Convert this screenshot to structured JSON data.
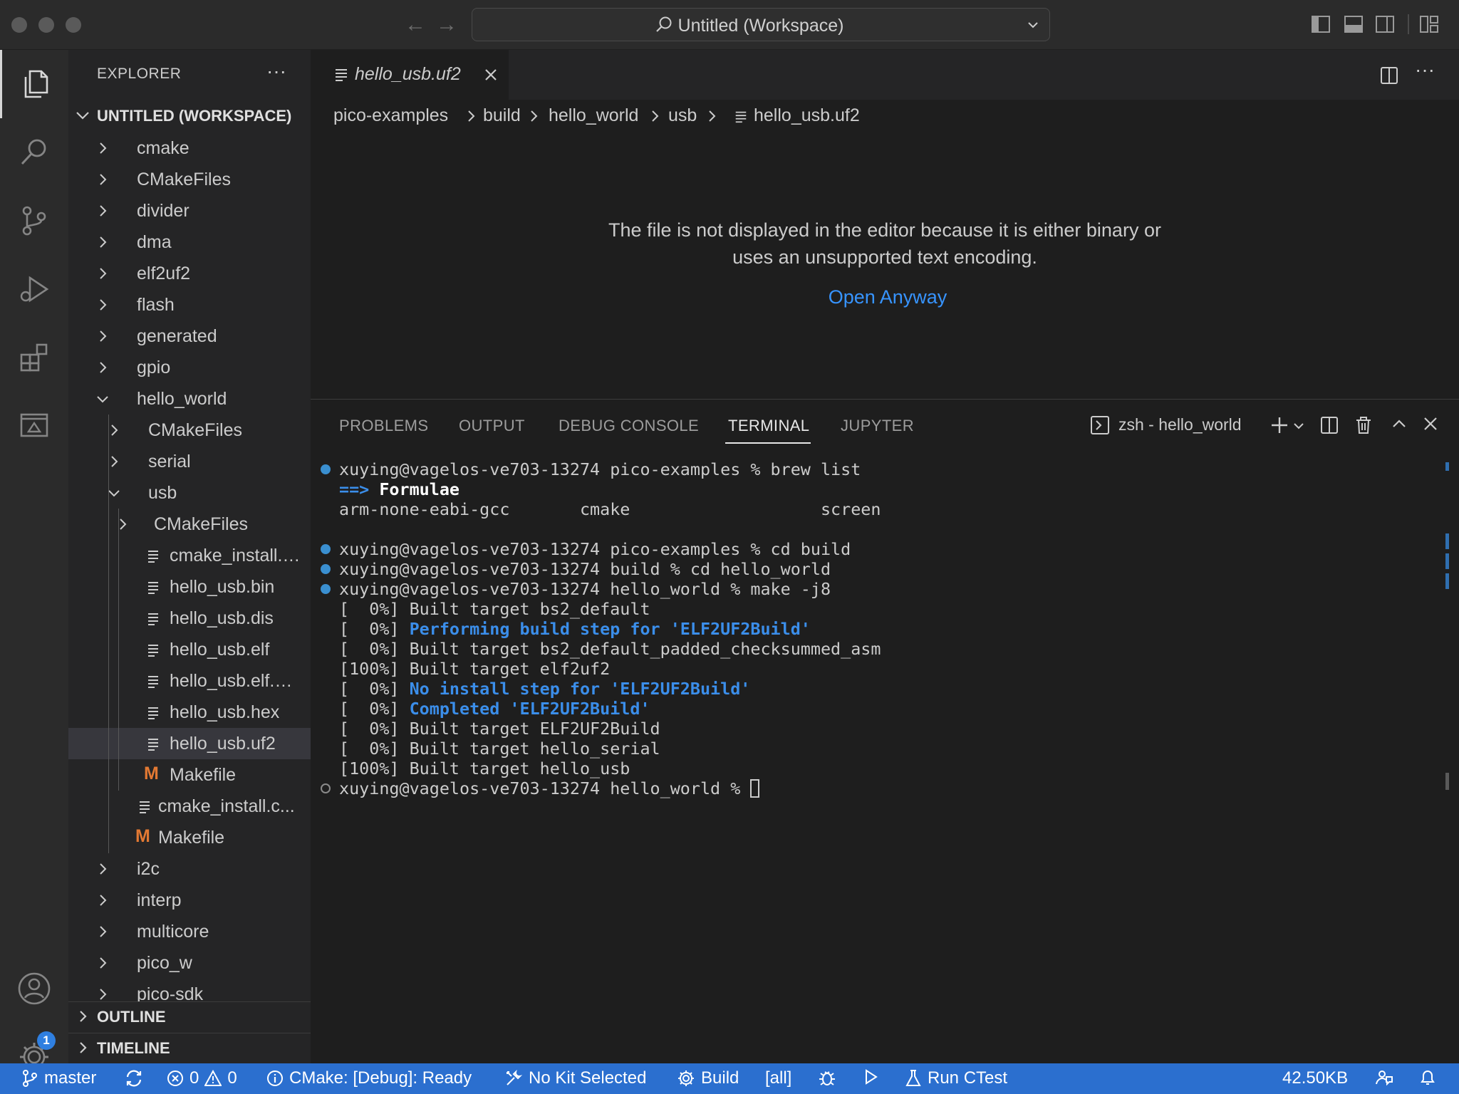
{
  "window": {
    "title": "Untitled (Workspace)"
  },
  "sidebar": {
    "header": "EXPLORER",
    "more": "···",
    "workspace": "UNTITLED (WORKSPACE)",
    "tree": [
      {
        "label": "cmake",
        "type": "folder",
        "expanded": false,
        "depth": 0
      },
      {
        "label": "CMakeFiles",
        "type": "folder",
        "expanded": false,
        "depth": 0
      },
      {
        "label": "divider",
        "type": "folder",
        "expanded": false,
        "depth": 0
      },
      {
        "label": "dma",
        "type": "folder",
        "expanded": false,
        "depth": 0
      },
      {
        "label": "elf2uf2",
        "type": "folder",
        "expanded": false,
        "depth": 0
      },
      {
        "label": "flash",
        "type": "folder",
        "expanded": false,
        "depth": 0
      },
      {
        "label": "generated",
        "type": "folder",
        "expanded": false,
        "depth": 0
      },
      {
        "label": "gpio",
        "type": "folder",
        "expanded": false,
        "depth": 0
      },
      {
        "label": "hello_world",
        "type": "folder",
        "expanded": true,
        "depth": 0
      },
      {
        "label": "CMakeFiles",
        "type": "folder",
        "expanded": false,
        "depth": 1
      },
      {
        "label": "serial",
        "type": "folder",
        "expanded": false,
        "depth": 1
      },
      {
        "label": "usb",
        "type": "folder",
        "expanded": true,
        "depth": 1
      },
      {
        "label": "CMakeFiles",
        "type": "folder",
        "expanded": false,
        "depth": 2
      },
      {
        "label": "cmake_install.c...",
        "type": "file",
        "depth": 2
      },
      {
        "label": "hello_usb.bin",
        "type": "file",
        "depth": 2
      },
      {
        "label": "hello_usb.dis",
        "type": "file",
        "depth": 2
      },
      {
        "label": "hello_usb.elf",
        "type": "file",
        "depth": 2
      },
      {
        "label": "hello_usb.elf.m...",
        "type": "file",
        "depth": 2
      },
      {
        "label": "hello_usb.hex",
        "type": "file",
        "depth": 2
      },
      {
        "label": "hello_usb.uf2",
        "type": "file",
        "depth": 2,
        "selected": true
      },
      {
        "label": "Makefile",
        "type": "makefile",
        "depth": 2
      },
      {
        "label": "cmake_install.c...",
        "type": "file",
        "depth": 1
      },
      {
        "label": "Makefile",
        "type": "makefile",
        "depth": 1
      },
      {
        "label": "i2c",
        "type": "folder",
        "expanded": false,
        "depth": 0
      },
      {
        "label": "interp",
        "type": "folder",
        "expanded": false,
        "depth": 0
      },
      {
        "label": "multicore",
        "type": "folder",
        "expanded": false,
        "depth": 0
      },
      {
        "label": "pico_w",
        "type": "folder",
        "expanded": false,
        "depth": 0
      },
      {
        "label": "pico-sdk",
        "type": "folder",
        "expanded": false,
        "depth": 0
      }
    ],
    "outline": "OUTLINE",
    "timeline": "TIMELINE"
  },
  "activity": {
    "settings_badge": "1"
  },
  "editor": {
    "tab_label": "hello_usb.uf2",
    "breadcrumb": [
      "pico-examples",
      "build",
      "hello_world",
      "usb",
      "hello_usb.uf2"
    ],
    "message_line1": "The file is not displayed in the editor because it is either binary or",
    "message_line2": "uses an unsupported text encoding.",
    "open_anyway": "Open Anyway"
  },
  "panel": {
    "tabs": [
      "PROBLEMS",
      "OUTPUT",
      "DEBUG CONSOLE",
      "TERMINAL",
      "JUPYTER"
    ],
    "active_tab": "TERMINAL",
    "terminal_name": "zsh - hello_world",
    "terminal": {
      "l1": "xuying@vagelos-ve703-13274 pico-examples % brew list",
      "l2_arrow": "==>",
      "l2_text": " Formulae",
      "l3": "arm-none-eabi-gcc       cmake                   screen",
      "l5": "xuying@vagelos-ve703-13274 pico-examples % cd build",
      "l6": "xuying@vagelos-ve703-13274 build % cd hello_world",
      "l7": "xuying@vagelos-ve703-13274 hello_world % make -j8",
      "l8": "[  0%] Built target bs2_default",
      "l9_prefix": "[  0%] ",
      "l9_hl": "Performing build step for 'ELF2UF2Build'",
      "l10": "[  0%] Built target bs2_default_padded_checksummed_asm",
      "l11": "[100%] Built target elf2uf2",
      "l12_prefix": "[  0%] ",
      "l12_hl": "No install step for 'ELF2UF2Build'",
      "l13_prefix": "[  0%] ",
      "l13_hl": "Completed 'ELF2UF2Build'",
      "l14": "[  0%] Built target ELF2UF2Build",
      "l15": "[  0%] Built target hello_serial",
      "l16": "[100%] Built target hello_usb",
      "l17": "xuying@vagelos-ve703-13274 hello_world % "
    }
  },
  "statusbar": {
    "branch": "master",
    "errors": "0",
    "warnings": "0",
    "cmake": "CMake: [Debug]: Ready",
    "kit": "No Kit Selected",
    "build": "Build",
    "target": "[all]",
    "ctest": "Run CTest",
    "filesize": "42.50KB"
  },
  "colors": {
    "accent": "#2b6fcf",
    "link": "#3794ff",
    "terminal_highlight": "#3b8eea",
    "makefile_icon": "#e37933"
  }
}
